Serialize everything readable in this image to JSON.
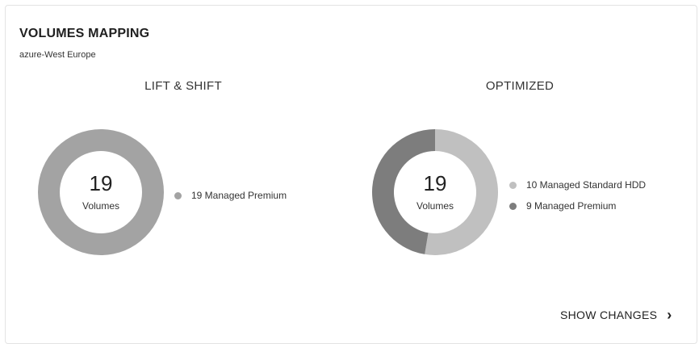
{
  "card": {
    "title": "VOLUMES MAPPING",
    "subtitle": "azure-West Europe"
  },
  "lift_shift": {
    "title": "LIFT & SHIFT",
    "total": "19",
    "total_label": "Volumes",
    "legend": [
      {
        "label": "19 Managed Premium",
        "value": 19,
        "color": "#a3a3a3"
      }
    ]
  },
  "optimized": {
    "title": "OPTIMIZED",
    "total": "19",
    "total_label": "Volumes",
    "legend": [
      {
        "label": "10 Managed Standard HDD",
        "value": 10,
        "color": "#c0c0c0"
      },
      {
        "label": "9 Managed Premium",
        "value": 9,
        "color": "#7d7d7d"
      }
    ]
  },
  "actions": {
    "show_changes": "SHOW CHANGES",
    "chevron_icon": "chevron-right-icon"
  }
}
